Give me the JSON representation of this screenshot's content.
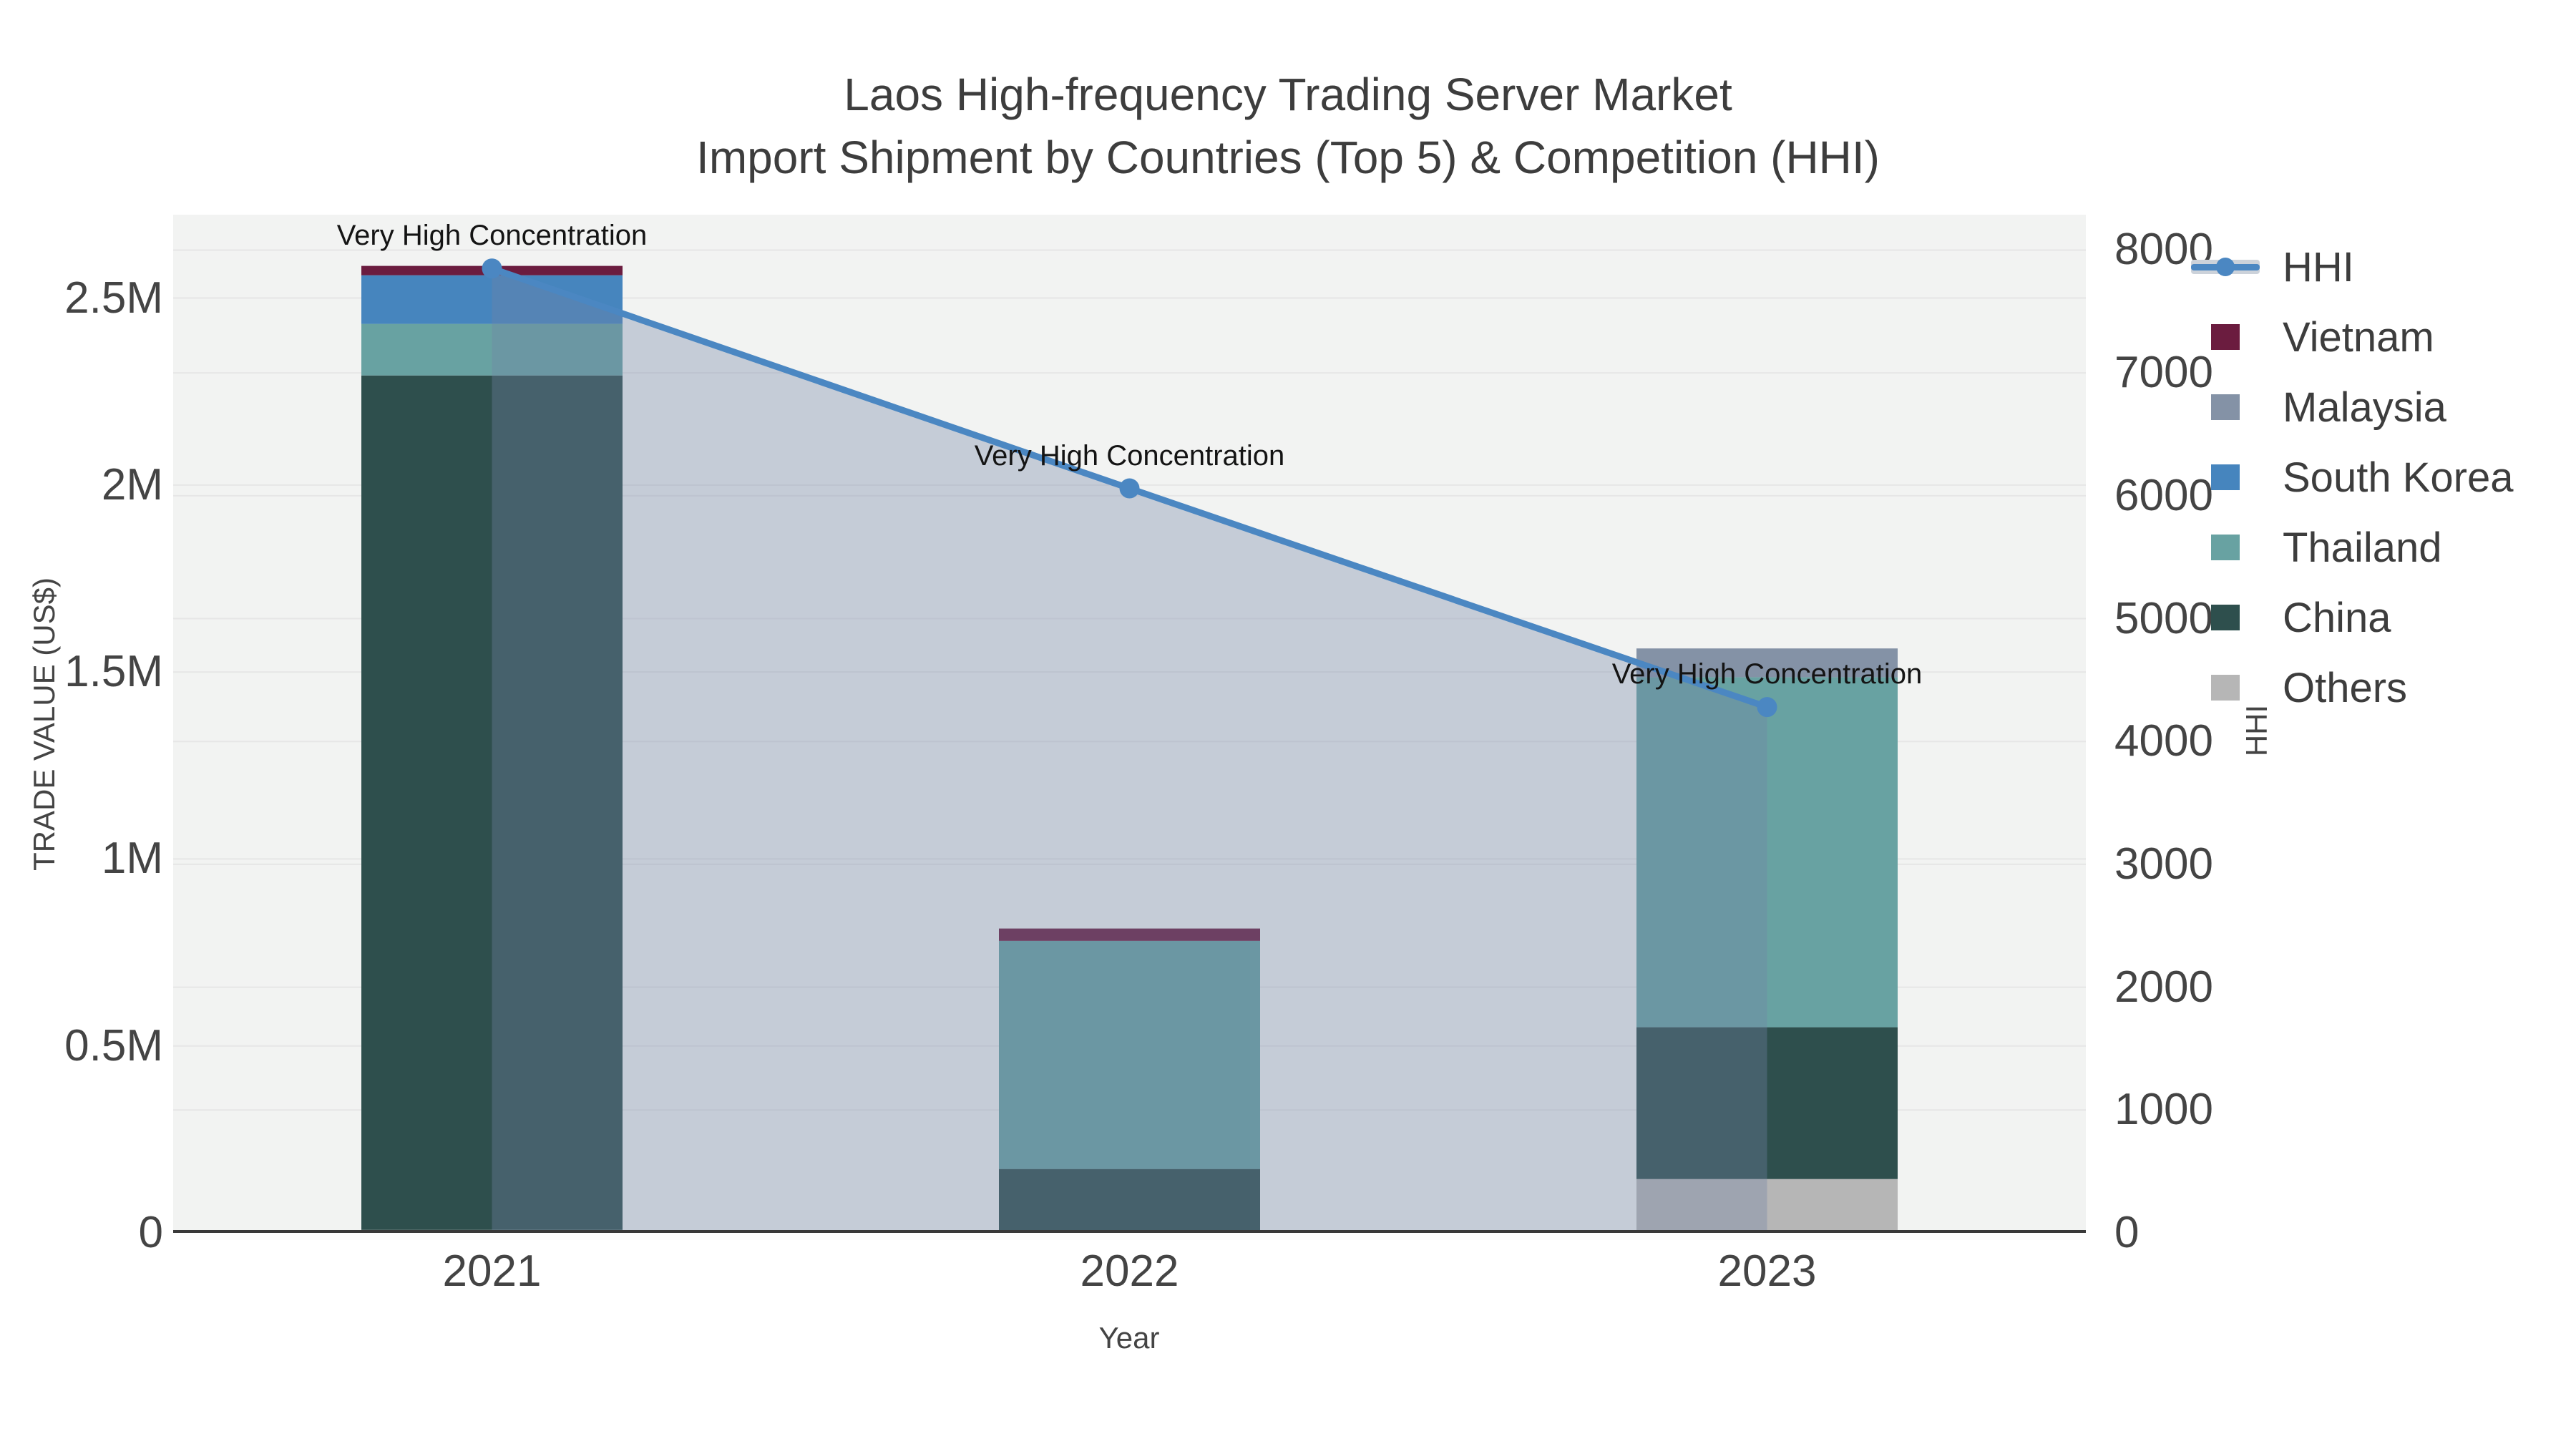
{
  "title": {
    "line1": "Laos High-frequency Trading Server Market",
    "line2": "Import Shipment by Countries (Top 5) & Competition (HHI)"
  },
  "axes": {
    "x": {
      "title": "Year",
      "categories": [
        "2021",
        "2022",
        "2023"
      ]
    },
    "y_left": {
      "title": "TRADE VALUE (US$)",
      "tick_labels": [
        "0",
        "0.5M",
        "1M",
        "1.5M",
        "2M",
        "2.5M"
      ],
      "tick_values": [
        0,
        500000,
        1000000,
        1500000,
        2000000,
        2500000
      ],
      "max": 2723000
    },
    "y_right": {
      "title": "HHI",
      "tick_labels": [
        "0",
        "1000",
        "2000",
        "3000",
        "4000",
        "5000",
        "6000",
        "7000",
        "8000"
      ],
      "tick_values": [
        0,
        1000,
        2000,
        3000,
        4000,
        5000,
        6000,
        7000,
        8000
      ],
      "max": 8288
    }
  },
  "legend": {
    "items": [
      {
        "label": "HHI",
        "marker": "line",
        "color": "#4B87C2"
      },
      {
        "label": "Vietnam",
        "marker": "square",
        "color": "#6B1C3F"
      },
      {
        "label": "Malaysia",
        "marker": "square",
        "color": "#8492A6"
      },
      {
        "label": "South Korea",
        "marker": "square",
        "color": "#4685BE"
      },
      {
        "label": "Thailand",
        "marker": "square",
        "color": "#68A2A2"
      },
      {
        "label": "China",
        "marker": "square",
        "color": "#2E4F4D"
      },
      {
        "label": "Others",
        "marker": "square",
        "color": "#B6B6B6"
      }
    ]
  },
  "annotations": [
    {
      "text": "Very High Concentration",
      "category": "2021"
    },
    {
      "text": "Very High Concentration",
      "category": "2022"
    },
    {
      "text": "Very High Concentration",
      "category": "2023"
    }
  ],
  "colors": {
    "plot_bg": "#F2F3F2",
    "gridline": "#E6E6E6",
    "axis_line": "#3A3A3A",
    "hhi_line": "#4B87C2",
    "hhi_fill": "rgba(115,132,165,0.35)"
  },
  "chart_data": {
    "type": "bar+line",
    "title": "Laos High-frequency Trading Server Market — Import Shipment by Countries (Top 5) & Competition (HHI)",
    "xlabel": "Year",
    "ylabel_left": "TRADE VALUE (US$)",
    "ylabel_right": "HHI",
    "categories": [
      "2021",
      "2022",
      "2023"
    ],
    "ylim_left": [
      0,
      2723000
    ],
    "ylim_right": [
      0,
      8288
    ],
    "grid": true,
    "legend_position": "right",
    "stack_order_bottom_to_top": [
      "Others",
      "China",
      "Thailand",
      "South Korea",
      "Malaysia",
      "Vietnam"
    ],
    "series": [
      {
        "name": "Vietnam",
        "type": "bar",
        "color": "#6B1C3F",
        "values": [
          25000,
          33000,
          0
        ]
      },
      {
        "name": "Malaysia",
        "type": "bar",
        "color": "#8492A6",
        "values": [
          0,
          0,
          77000
        ]
      },
      {
        "name": "South Korea",
        "type": "bar",
        "color": "#4685BE",
        "values": [
          130000,
          0,
          0
        ]
      },
      {
        "name": "Thailand",
        "type": "bar",
        "color": "#68A2A2",
        "values": [
          138000,
          610000,
          936000
        ]
      },
      {
        "name": "China",
        "type": "bar",
        "color": "#2E4F4D",
        "values": [
          2285000,
          167000,
          406000
        ]
      },
      {
        "name": "Others",
        "type": "bar",
        "color": "#B6B6B6",
        "values": [
          8000,
          4000,
          144000
        ]
      },
      {
        "name": "HHI",
        "type": "line",
        "axis": "right",
        "color": "#4B87C2",
        "fill_below": "rgba(115,132,165,0.35)",
        "values": [
          7850,
          6060,
          4280
        ]
      }
    ]
  }
}
